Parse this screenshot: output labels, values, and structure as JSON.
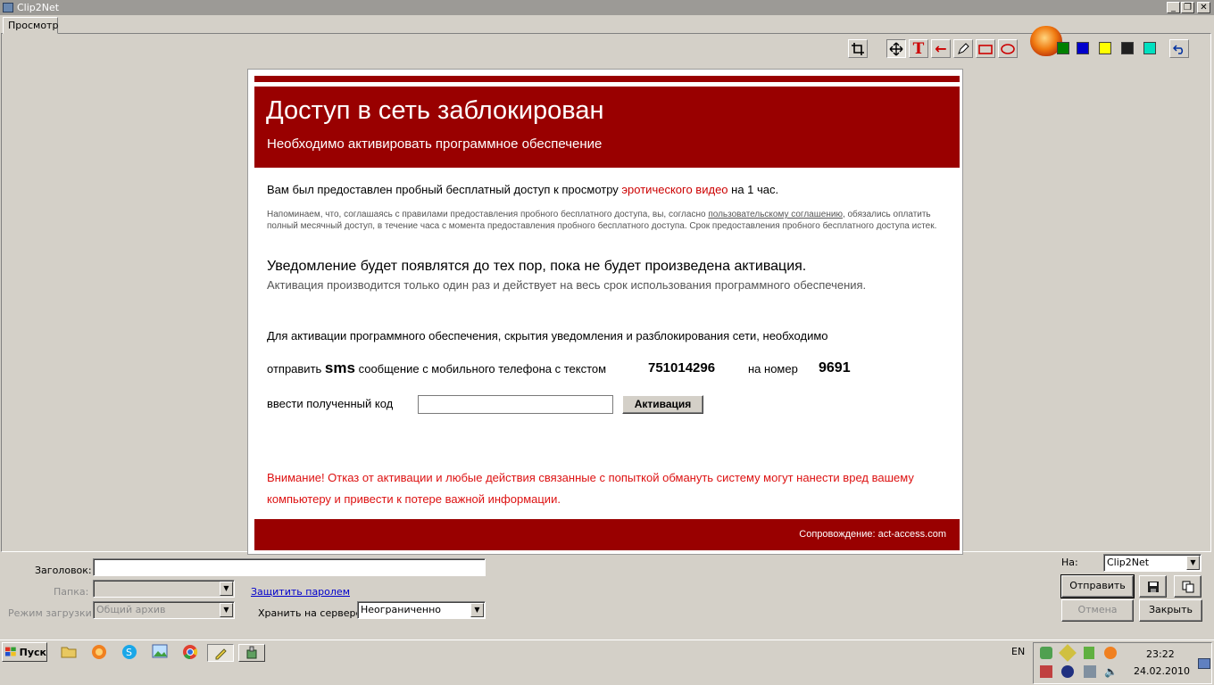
{
  "window": {
    "title": "Clip2Net",
    "minimize_label": "_",
    "restore_label": "❐",
    "close_label": "✕"
  },
  "tabs": [
    {
      "label": "Просмотр",
      "active": true
    }
  ],
  "toolbar": {
    "tools": [
      {
        "icon": "crop-icon"
      },
      {
        "icon": "move-icon",
        "pressed": true
      },
      {
        "icon": "text-tool-icon",
        "glyph": "T"
      },
      {
        "icon": "arrow-tool-icon",
        "glyph": "←"
      },
      {
        "icon": "pencil-tool-icon"
      },
      {
        "icon": "rectangle-tool-icon"
      },
      {
        "icon": "ellipse-tool-icon"
      }
    ],
    "colors": [
      "#008000",
      "#0000cc",
      "#ffff00",
      "#202020",
      "#00e0c0"
    ],
    "undo_icon": "undo-icon"
  },
  "capture": {
    "heading": "Доступ в сеть заблокирован",
    "subheading": "Необходимо активировать программное обеспечение",
    "intro_before": "Вам был предоставлен пробный бесплатный доступ к просмотру ",
    "intro_highlight": "эротического видео",
    "intro_after": " на 1 час.",
    "notice_before": "Напоминаем, что, соглашаясь с правилами предоставления пробного бесплатного доступа, вы, согласно ",
    "notice_link": "пользовательскому соглашению",
    "notice_after": ", обязались оплатить полный месячный доступ, в течение часа с момента предоставления пробного бесплатного доступа. Срок предоставления пробного бесплатного доступа истек.",
    "notify_heading": "Уведомление будет появлятся до тех пор, пока не будет произведена активация.",
    "notify_sub": "Активация производится только один раз и действует на весь срок использования программного обеспечения.",
    "activation_text": "Для активации программного обеспечения, скрытия уведомления и разблокирования сети, необходимо",
    "send_prefix": "отправить",
    "send_sms": "sms",
    "send_middle": "сообщение с мобильного телефона с текстом",
    "sms_text": "751014296",
    "to_number_label": "на номер",
    "sms_number": "9691",
    "code_label": "ввести полученный код",
    "code_value": "",
    "activate_label": "Активация",
    "warning": "Внимание! Отказ от активации и любые действия связанные с попыткой обмануть систему могут нанести вред вашему компьютеру и привести к потере важной информации.",
    "footer": "Сопровождение: act-access.com"
  },
  "form": {
    "title_label": "Заголовок:",
    "title_value": "",
    "folder_label": "Папка:",
    "folder_value": "",
    "protect_link": "Защитить паролем",
    "upload_mode_label": "Режим загрузки:",
    "upload_mode_value": "Общий архив",
    "store_label": "Хранить на сервере:",
    "store_value": "Неограниченно",
    "to_label": "На:",
    "to_value": "Clip2Net",
    "send_button": "Отправить",
    "cancel_button": "Отмена",
    "close_button": "Закрыть"
  },
  "taskbar": {
    "start_label": "Пуск",
    "quick_launch": [
      "folder-icon",
      "firefox-icon",
      "skype-icon",
      "image-viewer-icon",
      "chrome-icon",
      "clip2net-icon",
      "app-icon"
    ],
    "language": "EN",
    "time": "23:22",
    "date": "24.02.2010"
  }
}
